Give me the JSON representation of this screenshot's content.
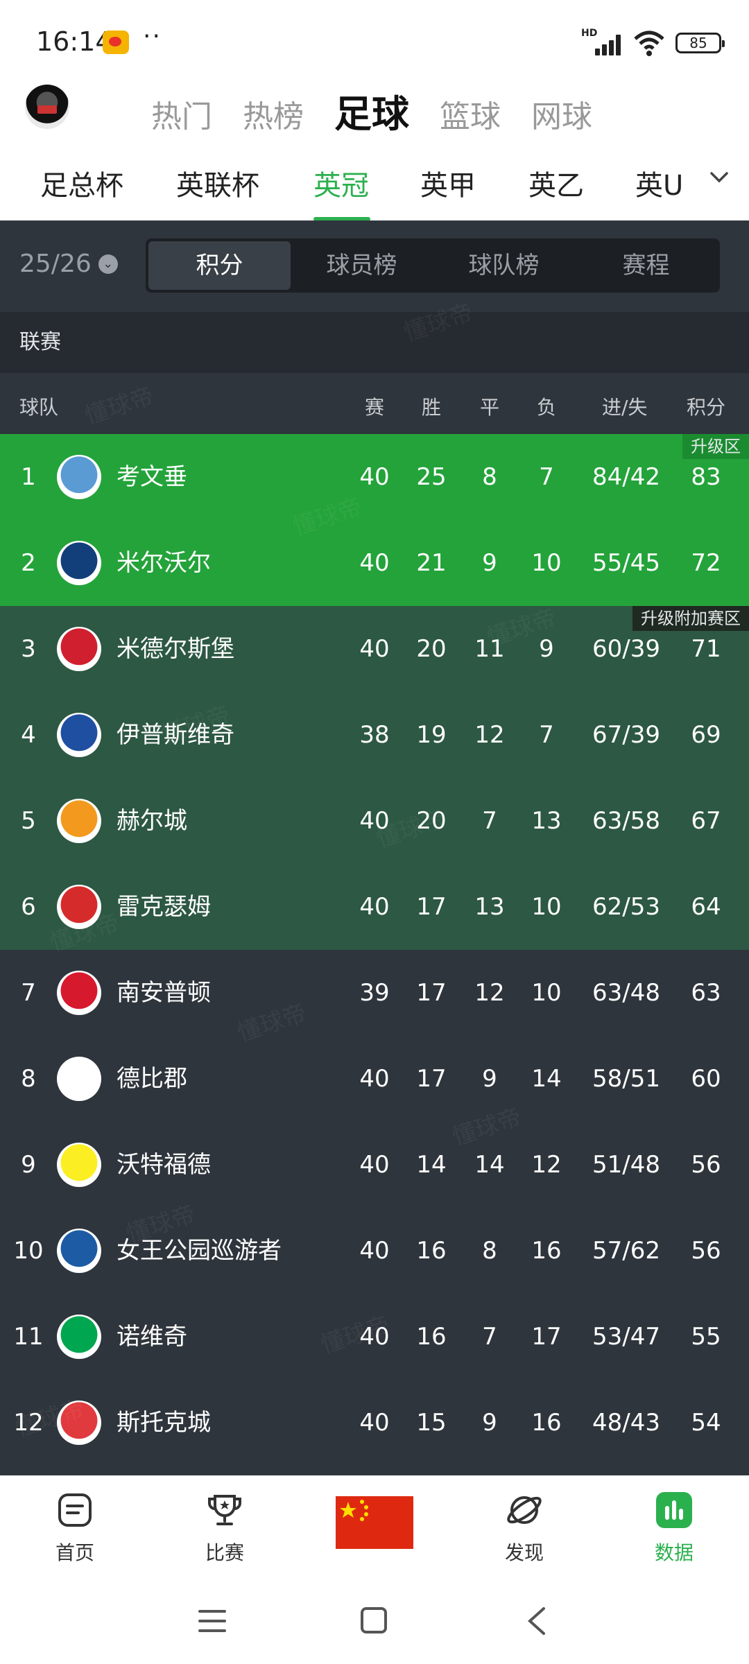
{
  "status_bar": {
    "time": "16:14",
    "dots": "··",
    "signal_label": "HD",
    "battery": "85"
  },
  "top_nav": {
    "tabs": [
      "热门",
      "热榜",
      "足球",
      "篮球",
      "网球"
    ],
    "active": 2
  },
  "sub_nav": {
    "tabs": [
      "足总杯",
      "英联杯",
      "英冠",
      "英甲",
      "英乙",
      "英U"
    ],
    "active": 2
  },
  "season": "25/26",
  "segment": {
    "tabs": [
      "积分",
      "球员榜",
      "球队榜",
      "赛程"
    ],
    "active": 0
  },
  "section_label": "联赛",
  "columns": {
    "team": "球队",
    "played": "赛",
    "won": "胜",
    "drawn": "平",
    "lost": "负",
    "goals": "进/失",
    "points": "积分"
  },
  "zones": {
    "promotion": "升级区",
    "playoff": "升级附加赛区"
  },
  "colors": {
    "accent": "#2bb04e",
    "promotion_bg": "#24a33a",
    "playoff_bg": "#2d5843",
    "dark_bg": "#2f353c"
  },
  "standings": [
    {
      "rank": "1",
      "team": "考文垂",
      "played": "40",
      "won": "25",
      "drawn": "8",
      "lost": "7",
      "goals": "84/42",
      "points": "83",
      "zone": "promotion",
      "logo_color": "#5a9bd4"
    },
    {
      "rank": "2",
      "team": "米尔沃尔",
      "played": "40",
      "won": "21",
      "drawn": "9",
      "lost": "10",
      "goals": "55/45",
      "points": "72",
      "zone": "promotion",
      "logo_color": "#123f7a"
    },
    {
      "rank": "3",
      "team": "米德尔斯堡",
      "played": "40",
      "won": "20",
      "drawn": "11",
      "lost": "9",
      "goals": "60/39",
      "points": "71",
      "zone": "playoff",
      "logo_color": "#d0202f"
    },
    {
      "rank": "4",
      "team": "伊普斯维奇",
      "played": "38",
      "won": "19",
      "drawn": "12",
      "lost": "7",
      "goals": "67/39",
      "points": "69",
      "zone": "playoff",
      "logo_color": "#1f4fa0"
    },
    {
      "rank": "5",
      "team": "赫尔城",
      "played": "40",
      "won": "20",
      "drawn": "7",
      "lost": "13",
      "goals": "63/58",
      "points": "67",
      "zone": "playoff",
      "logo_color": "#f39a1e"
    },
    {
      "rank": "6",
      "team": "雷克瑟姆",
      "played": "40",
      "won": "17",
      "drawn": "13",
      "lost": "10",
      "goals": "62/53",
      "points": "64",
      "zone": "playoff",
      "logo_color": "#d62b2b"
    },
    {
      "rank": "7",
      "team": "南安普顿",
      "played": "39",
      "won": "17",
      "drawn": "12",
      "lost": "10",
      "goals": "63/48",
      "points": "63",
      "zone": "",
      "logo_color": "#d7192e"
    },
    {
      "rank": "8",
      "team": "德比郡",
      "played": "40",
      "won": "17",
      "drawn": "9",
      "lost": "14",
      "goals": "58/51",
      "points": "60",
      "zone": "",
      "logo_color": "#ffffff"
    },
    {
      "rank": "9",
      "team": "沃特福德",
      "played": "40",
      "won": "14",
      "drawn": "14",
      "lost": "12",
      "goals": "51/48",
      "points": "56",
      "zone": "",
      "logo_color": "#fbee23"
    },
    {
      "rank": "10",
      "team": "女王公园巡游者",
      "played": "40",
      "won": "16",
      "drawn": "8",
      "lost": "16",
      "goals": "57/62",
      "points": "56",
      "zone": "",
      "logo_color": "#1d5ba4"
    },
    {
      "rank": "11",
      "team": "诺维奇",
      "played": "40",
      "won": "16",
      "drawn": "7",
      "lost": "17",
      "goals": "53/47",
      "points": "55",
      "zone": "",
      "logo_color": "#00a650"
    },
    {
      "rank": "12",
      "team": "斯托克城",
      "played": "40",
      "won": "15",
      "drawn": "9",
      "lost": "16",
      "goals": "48/43",
      "points": "54",
      "zone": "",
      "logo_color": "#e03a3e"
    }
  ],
  "tab_bar": {
    "home": "首页",
    "match": "比赛",
    "discover": "发现",
    "data": "数据",
    "active": "data"
  }
}
